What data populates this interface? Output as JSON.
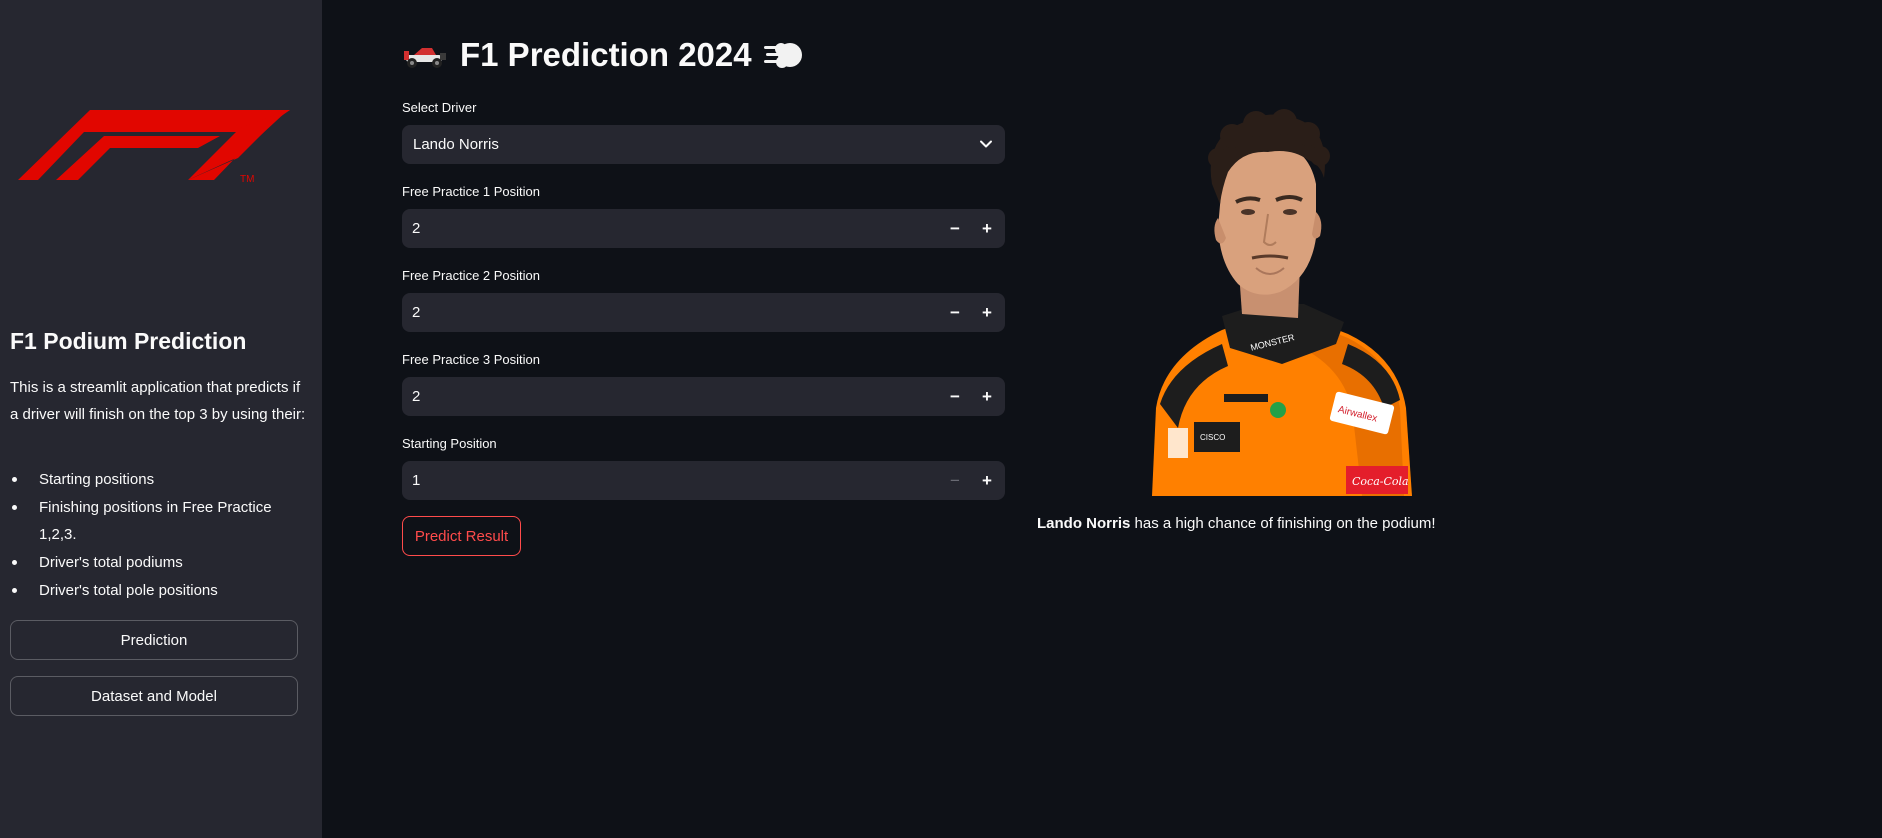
{
  "sidebar": {
    "title": "F1 Podium Prediction",
    "description": "This is a streamlit application that predicts if a driver will finish on the top 3 by using their:",
    "features": [
      "Starting positions",
      "Finishing positions in Free Practice 1,2,3.",
      "Driver's total podiums",
      "Driver's total pole positions"
    ],
    "nav_buttons": {
      "prediction": "Prediction",
      "dataset": "Dataset and Model"
    },
    "logo_trademark": "TM"
  },
  "main": {
    "title": "F1 Prediction 2024",
    "title_icons": [
      "racing-car-icon",
      "dash-icon"
    ],
    "driver_select": {
      "label": "Select Driver",
      "selected": "Lando Norris"
    },
    "fp1": {
      "label": "Free Practice 1 Position",
      "value": "2"
    },
    "fp2": {
      "label": "Free Practice 2 Position",
      "value": "2"
    },
    "fp3": {
      "label": "Free Practice 3 Position",
      "value": "2"
    },
    "start": {
      "label": "Starting Position",
      "value": "1"
    },
    "predict_button": "Predict Result",
    "result": {
      "driver": "Lando Norris",
      "message": " has a high chance of finishing on the podium!"
    }
  },
  "colors": {
    "background": "#0e1117",
    "sidebar": "#262730",
    "accent": "#ff4b4b",
    "f1_red": "#e10600",
    "team_orange": "#ff8000"
  }
}
